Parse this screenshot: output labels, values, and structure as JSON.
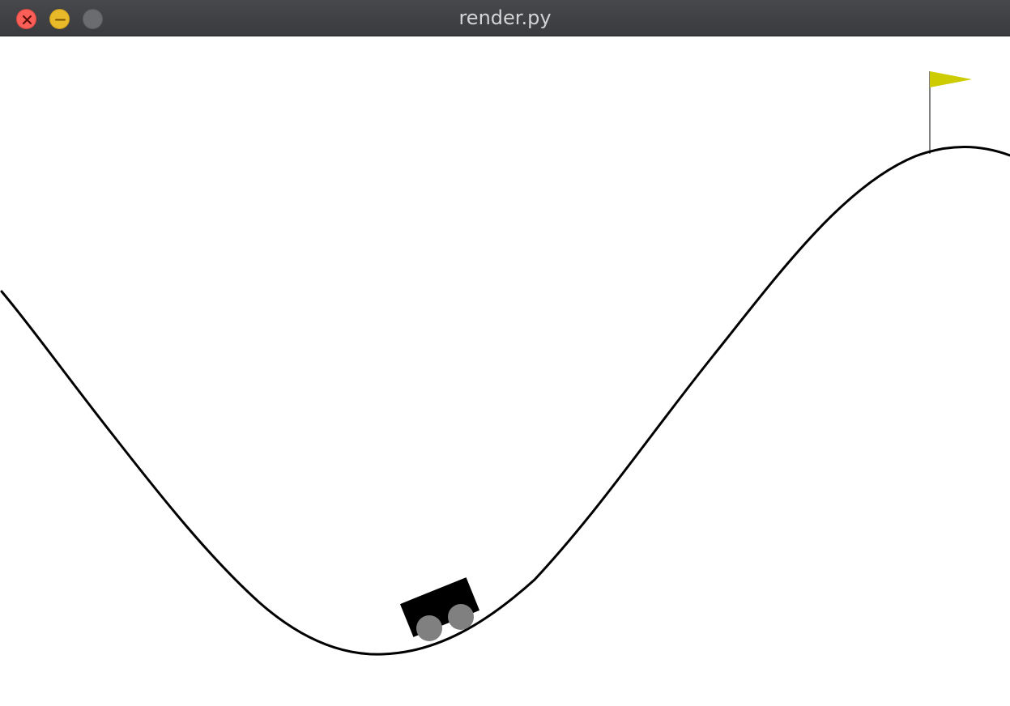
{
  "window": {
    "title": "render.py",
    "buttons": [
      {
        "name": "close",
        "icon": "close-icon",
        "color": "#fb5f57"
      },
      {
        "name": "minimize",
        "icon": "minimize-icon",
        "color": "#e8b928"
      },
      {
        "name": "zoom",
        "icon": "zoom-icon",
        "color": "#6b6c6f"
      }
    ]
  },
  "scene": {
    "environment": "mountain-car",
    "track_color": "#000000",
    "car_color": "#000000",
    "wheel_color": "#808080",
    "flag_color": "#cccc00",
    "flagpole_color": "#000000"
  }
}
